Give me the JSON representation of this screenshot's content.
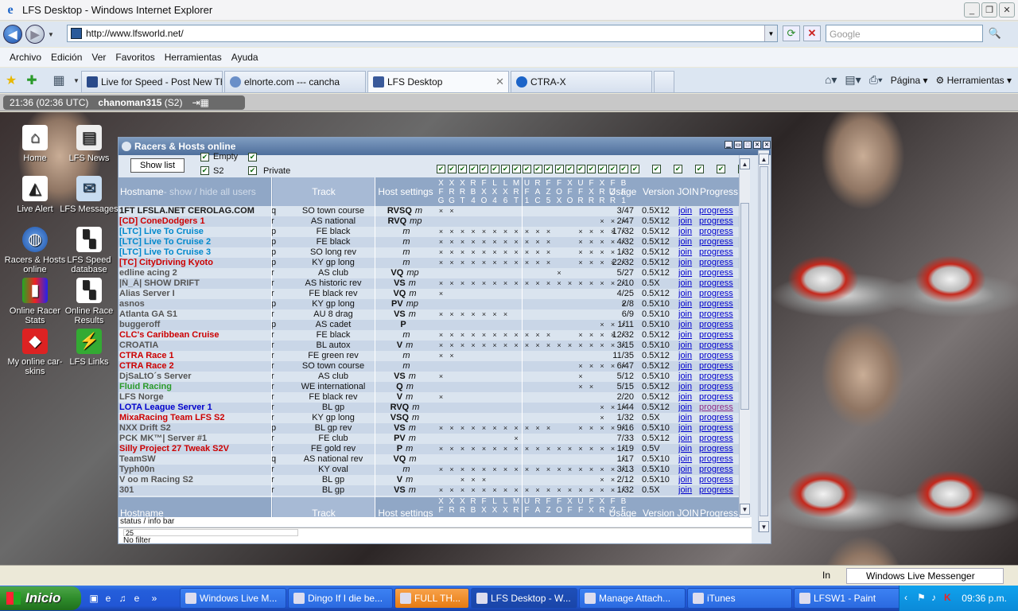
{
  "window": {
    "title": "LFS Desktop - Windows Internet Explorer"
  },
  "address": {
    "url": "http://www.lfsworld.net/",
    "search_placeholder": "Google"
  },
  "menu": [
    "Archivo",
    "Edición",
    "Ver",
    "Favoritos",
    "Herramientas",
    "Ayuda"
  ],
  "tabs": [
    {
      "label": "Live for Speed - Post New Th..."
    },
    {
      "label": "elnorte.com --- cancha"
    },
    {
      "label": "LFS Desktop"
    },
    {
      "label": "CTRA-X"
    }
  ],
  "toolbar": {
    "page_label": "Página",
    "tools_label": "Herramientas"
  },
  "lfsbar": {
    "time": "21:36 (02:36 UTC)",
    "user": "chanoman315",
    "license": "(S2)"
  },
  "desktop_icons": [
    {
      "label": "Home"
    },
    {
      "label": "LFS News"
    },
    {
      "label": "Live Alert"
    },
    {
      "label": "LFS Messages"
    },
    {
      "label": "Racers & Hosts online"
    },
    {
      "label": "LFS Speed database"
    },
    {
      "label": "Online Racer Stats"
    },
    {
      "label": "Online Race Results"
    },
    {
      "label": "My online car-skins"
    },
    {
      "label": "LFS Links"
    }
  ],
  "lfswin": {
    "title": "Racers & Hosts online",
    "show_list": "Show list",
    "filter_s2": "S2",
    "filter_private": "Private",
    "filter_empty": "Empty",
    "col_hostname": "Hostname",
    "col_showhide": " - show / hide all users",
    "col_track": "Track",
    "col_settings": "Host settings",
    "col_usage": "Usage",
    "col_version": "Version",
    "col_join": "JOIN",
    "col_progress": "Progress",
    "car_cols": [
      "XFG",
      "XRG",
      "XRT",
      "RB4",
      "FXO",
      "LX4",
      "LX6",
      "MRT",
      "UF1",
      "RAC",
      "FZ5",
      "FOX",
      "XFO",
      "UFR",
      "FXR",
      "XRR",
      "FZR",
      "BF1"
    ],
    "status_label": "status / info bar",
    "count": "25",
    "filter_status": "No filter"
  },
  "rows": [
    {
      "host": "1FT LFSLA.NET CEROLAG.COM",
      "type": "q",
      "track": "SO town course",
      "set": "RVSQ",
      "mode": "m",
      "flags": "110000000000000000",
      "usage": "3/47",
      "ver": "0.5X12"
    },
    {
      "host": "[CD] ConeDodgers 1",
      "type": "r",
      "track": "AS national",
      "set": "RVQ",
      "mode": "mp",
      "flags": "000000000000000111",
      "usage": "2/47",
      "ver": "0.5X12"
    },
    {
      "host": "[LTC] Live To Cruise",
      "type": "p",
      "track": "FE black",
      "set": "",
      "mode": "m",
      "flags": "111111111110011111",
      "usage": "17/32",
      "ver": "0.5X12"
    },
    {
      "host": "[LTC] Live To Cruise 2",
      "type": "p",
      "track": "FE black",
      "set": "",
      "mode": "m",
      "flags": "111111111110011111",
      "usage": "4/32",
      "ver": "0.5X12"
    },
    {
      "host": "[LTC] Live To Cruise 3",
      "type": "p",
      "track": "SO long rev",
      "set": "",
      "mode": "m",
      "flags": "111111111110011111",
      "usage": "1/32",
      "ver": "0.5X12"
    },
    {
      "host": "[TC] CityDriving Kyoto",
      "type": "p",
      "track": "KY gp long",
      "set": "",
      "mode": "m",
      "flags": "111111111110011111",
      "usage": "22/32",
      "ver": "0.5X12"
    },
    {
      "host": "edline acing 2",
      "type": "r",
      "track": "AS club",
      "set": "VQ",
      "mode": "mp",
      "flags": "000000000001000000",
      "usage": "5/27",
      "ver": "0.5X12"
    },
    {
      "host": "|Ñ_Ã| SHOW DRIFT",
      "type": "r",
      "track": "AS historic rev",
      "set": "VS",
      "mode": "m",
      "flags": "111111111111111111",
      "usage": "2/10",
      "ver": "0.5X"
    },
    {
      "host": "Alias Server I",
      "type": "r",
      "track": "FE black rev",
      "set": "VQ",
      "mode": "m",
      "flags": "100000000000000000",
      "usage": "4/25",
      "ver": "0.5X12"
    },
    {
      "host": "asnos",
      "type": "p",
      "track": "KY gp long",
      "set": "PV",
      "mode": "mp",
      "flags": "000000000000000001",
      "usage": "2/8",
      "ver": "0.5X10"
    },
    {
      "host": "Atlanta GA S1",
      "type": "r",
      "track": "AU 8 drag",
      "set": "VS",
      "mode": "m",
      "flags": "111111100000000000",
      "usage": "6/9",
      "ver": "0.5X10"
    },
    {
      "host": "buggeroff",
      "type": "p",
      "track": "AS cadet",
      "set": "P",
      "mode": "",
      "flags": "000000000000000111",
      "usage": "1/11",
      "ver": "0.5X10"
    },
    {
      "host": "CLC's Caribbean Cruise",
      "type": "r",
      "track": "FE black",
      "set": "",
      "mode": "m",
      "flags": "111111111110011111",
      "usage": "12/32",
      "ver": "0.5X12"
    },
    {
      "host": "CROATIA",
      "type": "r",
      "track": "BL autox",
      "set": "V",
      "mode": "m",
      "flags": "111111111111111111",
      "usage": "3/15",
      "ver": "0.5X10"
    },
    {
      "host": "CTRA Race 1",
      "type": "r",
      "track": "FE green rev",
      "set": "",
      "mode": "m",
      "flags": "110000000000000000",
      "usage": "11/35",
      "ver": "0.5X12"
    },
    {
      "host": "CTRA Race 2",
      "type": "r",
      "track": "SO town course",
      "set": "",
      "mode": "m",
      "flags": "000000000000011111",
      "usage": "6/47",
      "ver": "0.5X12"
    },
    {
      "host": "DjSaLtO´s Server",
      "type": "r",
      "track": "AS club",
      "set": "VS",
      "mode": "m",
      "flags": "100000000000010000",
      "usage": "5/12",
      "ver": "0.5X10"
    },
    {
      "host": "Fluid Racing",
      "type": "r",
      "track": "WE international",
      "set": "Q",
      "mode": "m",
      "flags": "000000000000011000",
      "usage": "5/15",
      "ver": "0.5X12"
    },
    {
      "host": "LFS Norge",
      "type": "r",
      "track": "FE black rev",
      "set": "V",
      "mode": "m",
      "flags": "100000000000000000",
      "usage": "2/20",
      "ver": "0.5X12"
    },
    {
      "host": "LOTA League Server 1",
      "type": "r",
      "track": "BL gp",
      "set": "RVQ",
      "mode": "m",
      "flags": "000000000000000111",
      "usage": "1/44",
      "ver": "0.5X12"
    },
    {
      "host": "MixaRacing Team LFS S2",
      "type": "r",
      "track": "KY gp long",
      "set": "VSQ",
      "mode": "m",
      "flags": "000000000000000100",
      "usage": "1/32",
      "ver": "0.5X"
    },
    {
      "host": "NXX Drift S2",
      "type": "p",
      "track": "BL gp rev",
      "set": "VS",
      "mode": "m",
      "flags": "111111111110011111",
      "usage": "9/16",
      "ver": "0.5X10"
    },
    {
      "host": "PCK MK™| Server #1",
      "type": "r",
      "track": "FE club",
      "set": "PV",
      "mode": "m",
      "flags": "000000010000000000",
      "usage": "7/33",
      "ver": "0.5X12"
    },
    {
      "host": "Silly Project 27 Tweak S2V",
      "type": "r",
      "track": "FE gold rev",
      "set": "P",
      "mode": "m",
      "flags": "111111111111111111",
      "usage": "1/19",
      "ver": "0.5V"
    },
    {
      "host": "TeamSW",
      "type": "q",
      "track": "AS national rev",
      "set": "VQ",
      "mode": "m",
      "flags": "000000000000000001",
      "usage": "1/17",
      "ver": "0.5X10"
    },
    {
      "host": "Typh00n",
      "type": "r",
      "track": "KY oval",
      "set": "",
      "mode": "m",
      "flags": "111111111111111111",
      "usage": "3/13",
      "ver": "0.5X10"
    },
    {
      "host": "V oo m Racing S2",
      "type": "r",
      "track": "BL gp",
      "set": "V",
      "mode": "m",
      "flags": "001110000000000110",
      "usage": "2/12",
      "ver": "0.5X10"
    },
    {
      "host": "301",
      "type": "r",
      "track": "BL gp",
      "set": "VS",
      "mode": "m",
      "flags": "111111111111111111",
      "usage": "1/32",
      "ver": "0.5X"
    }
  ],
  "link_join": "join",
  "link_progress": "progress",
  "iestatus": {
    "messenger": "Windows Live Messenger",
    "zone": "In"
  },
  "taskbar": {
    "start": "Inicio",
    "tasks": [
      "Windows Live M...",
      "Dingo If I die be...",
      "FULL TH...",
      "LFS Desktop - W...",
      "Manage Attach...",
      "iTunes",
      "LFSW1 - Paint"
    ],
    "clock": "09:36 p.m."
  },
  "colors": {
    "accent": "#90a7c6",
    "link": "#0000cc",
    "taskbar": "#245edb"
  }
}
